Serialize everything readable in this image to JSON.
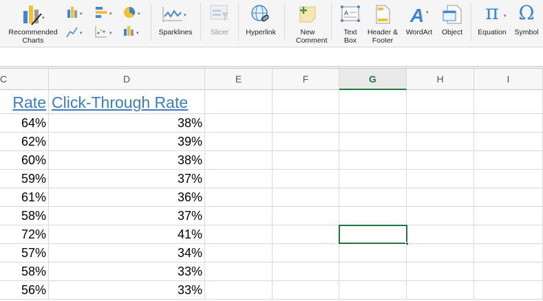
{
  "ribbon": {
    "recommended_charts": "Recommended Charts",
    "sparklines": "Sparklines",
    "slicer": "Slicer",
    "hyperlink": "Hyperlink",
    "new_comment": "New Comment",
    "text_box": "Text Box",
    "header_footer": "Header & Footer",
    "wordart": "WordArt",
    "object": "Object",
    "equation": "Equation",
    "symbol": "Symbol",
    "pi_glyph": "π",
    "omega_glyph": "Ω"
  },
  "columns": [
    "C",
    "D",
    "E",
    "F",
    "G",
    "H",
    "I"
  ],
  "selected_column": "G",
  "selected_cell": "G8",
  "table": {
    "headers": {
      "C": "Rate",
      "D": "Click-Through Rate"
    },
    "rows": [
      {
        "C": "64%",
        "D": "38%"
      },
      {
        "C": "62%",
        "D": "39%"
      },
      {
        "C": "60%",
        "D": "38%"
      },
      {
        "C": "59%",
        "D": "37%"
      },
      {
        "C": "61%",
        "D": "36%"
      },
      {
        "C": "58%",
        "D": "37%"
      },
      {
        "C": "72%",
        "D": "41%"
      },
      {
        "C": "57%",
        "D": "34%"
      },
      {
        "C": "58%",
        "D": "33%"
      },
      {
        "C": "56%",
        "D": "33%"
      }
    ]
  },
  "colors": {
    "accent": "#217346",
    "link": "#3c7cc0"
  }
}
